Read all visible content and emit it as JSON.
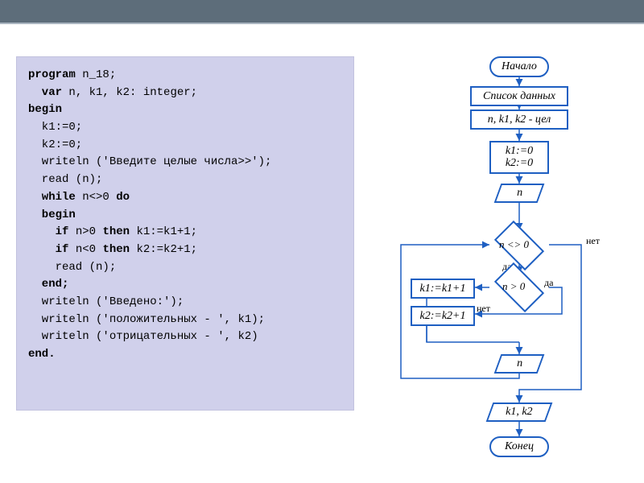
{
  "code": {
    "l1a": "program",
    "l1b": " n_18;",
    "l2a": "  var",
    "l2b": " n, k1, k2: integer;",
    "l3": "begin",
    "l4": "  k1:=0;",
    "l5": "  k2:=0;",
    "l6": "  writeln ('Введите целые числа>>');",
    "l7": "  read (n);",
    "l8a": "  while",
    "l8b": " n<>0 ",
    "l8c": "do",
    "l9": "  begin",
    "l10a": "    if",
    "l10b": " n>0 ",
    "l10c": "then",
    "l10d": " k1:=k1+1;",
    "l11a": "    if",
    "l11b": " n<0 ",
    "l11c": "then",
    "l11d": " k2:=k2+1;",
    "l12": "    read (n);",
    "l13": "  end;",
    "l14": "  writeln ('Введено:');",
    "l15": "  writeln ('положительных - ', k1);",
    "l16": "  writeln ('отрицательных - ', k2)",
    "l17": "end."
  },
  "flow": {
    "start": "Начало",
    "spisok": "Список данных",
    "vars": "n, k1, k2 - цел",
    "init": "k1:=0\nk2:=0",
    "read_n1": "n",
    "cond1": "n <> 0",
    "cond2": "n > 0",
    "assign1": "k1:=k1+1",
    "assign2": "k2:=k2+1",
    "read_n2": "n",
    "output": "k1, k2",
    "end": "Конец",
    "yes": "да",
    "no": "нет"
  }
}
